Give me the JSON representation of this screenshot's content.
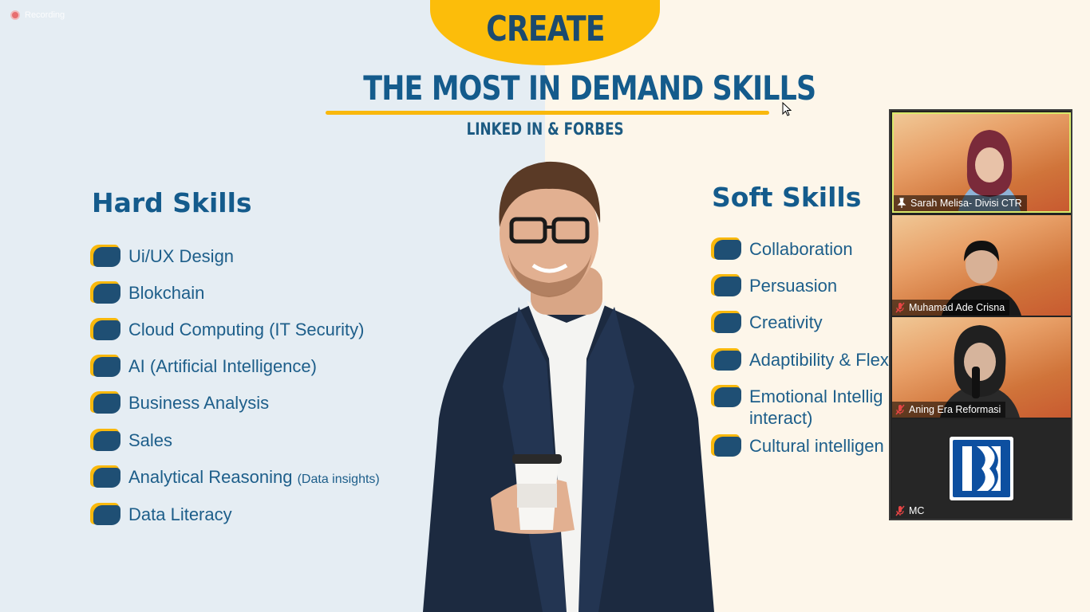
{
  "recording": {
    "label": "Recording"
  },
  "slide": {
    "create_label": "CREATE",
    "title": "THE MOST IN DEMAND SKILLS",
    "subtitle": "LINKED IN & FORBES",
    "hard_skills": {
      "title": "Hard Skills",
      "items": [
        {
          "label": "Ui/UX Design"
        },
        {
          "label": "Blokchain"
        },
        {
          "label": "Cloud Computing (IT Security)"
        },
        {
          "label": "AI (Artificial Intelligence)"
        },
        {
          "label": "Business Analysis"
        },
        {
          "label": "Sales"
        },
        {
          "label": "Analytical Reasoning",
          "note": "(Data insights)"
        },
        {
          "label": "Data Literacy"
        }
      ]
    },
    "soft_skills": {
      "title": "Soft Skills",
      "items": [
        {
          "label": "Collaboration"
        },
        {
          "label": "Persuasion"
        },
        {
          "label": "Creativity"
        },
        {
          "label": "Adaptibility & Flex"
        },
        {
          "label": "Emotional Intellig",
          "label_line2": "interact)"
        },
        {
          "label": "Cultural intelligen"
        }
      ]
    }
  },
  "participants": [
    {
      "name": "Sarah Melisa- Divisi CTR",
      "status": "speaking",
      "icon": "pin-icon"
    },
    {
      "name": "Muhamad Ade Crisna",
      "status": "muted",
      "icon": "mic-muted-icon"
    },
    {
      "name": "Aning Era Reformasi",
      "status": "muted",
      "icon": "mic-muted-icon"
    },
    {
      "name": "MC",
      "status": "muted",
      "icon": "mic-muted-icon",
      "avatar": "BRI logo"
    }
  ],
  "colors": {
    "accent_yellow": "#fcbd0a",
    "title_blue": "#145b8c",
    "bullet_blue": "#1f4f74"
  }
}
